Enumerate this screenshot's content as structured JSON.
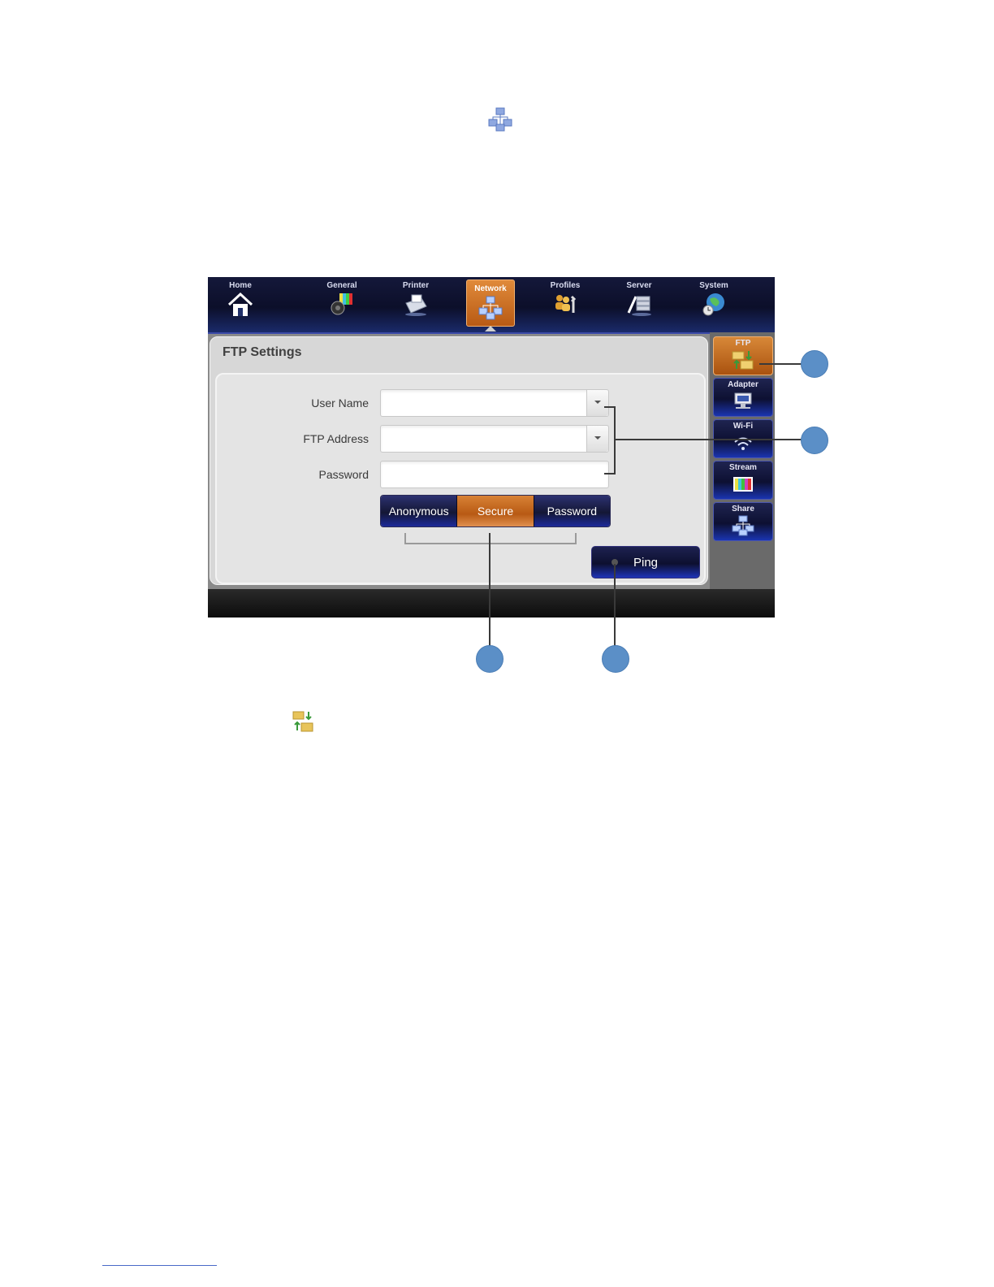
{
  "doc": {
    "icons": [
      "network-icon",
      "ftp-icon"
    ]
  },
  "nav": {
    "items": [
      {
        "label": "Home",
        "icon": "home-icon"
      },
      {
        "label": "General",
        "icon": "general-icon"
      },
      {
        "label": "Printer",
        "icon": "printer-icon"
      },
      {
        "label": "Network",
        "icon": "network-icon",
        "active": true
      },
      {
        "label": "Profiles",
        "icon": "profiles-icon"
      },
      {
        "label": "Server",
        "icon": "server-icon"
      },
      {
        "label": "System",
        "icon": "system-globe-icon"
      }
    ]
  },
  "panel": {
    "title": "FTP Settings",
    "fields": {
      "user_name_label": "User Name",
      "user_name_value": "",
      "ftp_address_label": "FTP Address",
      "ftp_address_value": "",
      "password_label": "Password",
      "password_value": ""
    },
    "modes": [
      {
        "label": "Anonymous",
        "active": false
      },
      {
        "label": "Secure",
        "active": true
      },
      {
        "label": "Password",
        "active": false
      }
    ],
    "ping_label": "Ping"
  },
  "sidebar": {
    "items": [
      {
        "label": "FTP",
        "icon": "ftp-icon",
        "active": true
      },
      {
        "label": "Adapter",
        "icon": "adapter-icon"
      },
      {
        "label": "Wi-Fi",
        "icon": "wifi-icon"
      },
      {
        "label": "Stream",
        "icon": "stream-icon"
      },
      {
        "label": "Share",
        "icon": "share-icon"
      }
    ]
  },
  "colors": {
    "accent_orange": "#c8641c",
    "nav_blue": "#141735",
    "callout_blue": "#5b8fc7"
  }
}
